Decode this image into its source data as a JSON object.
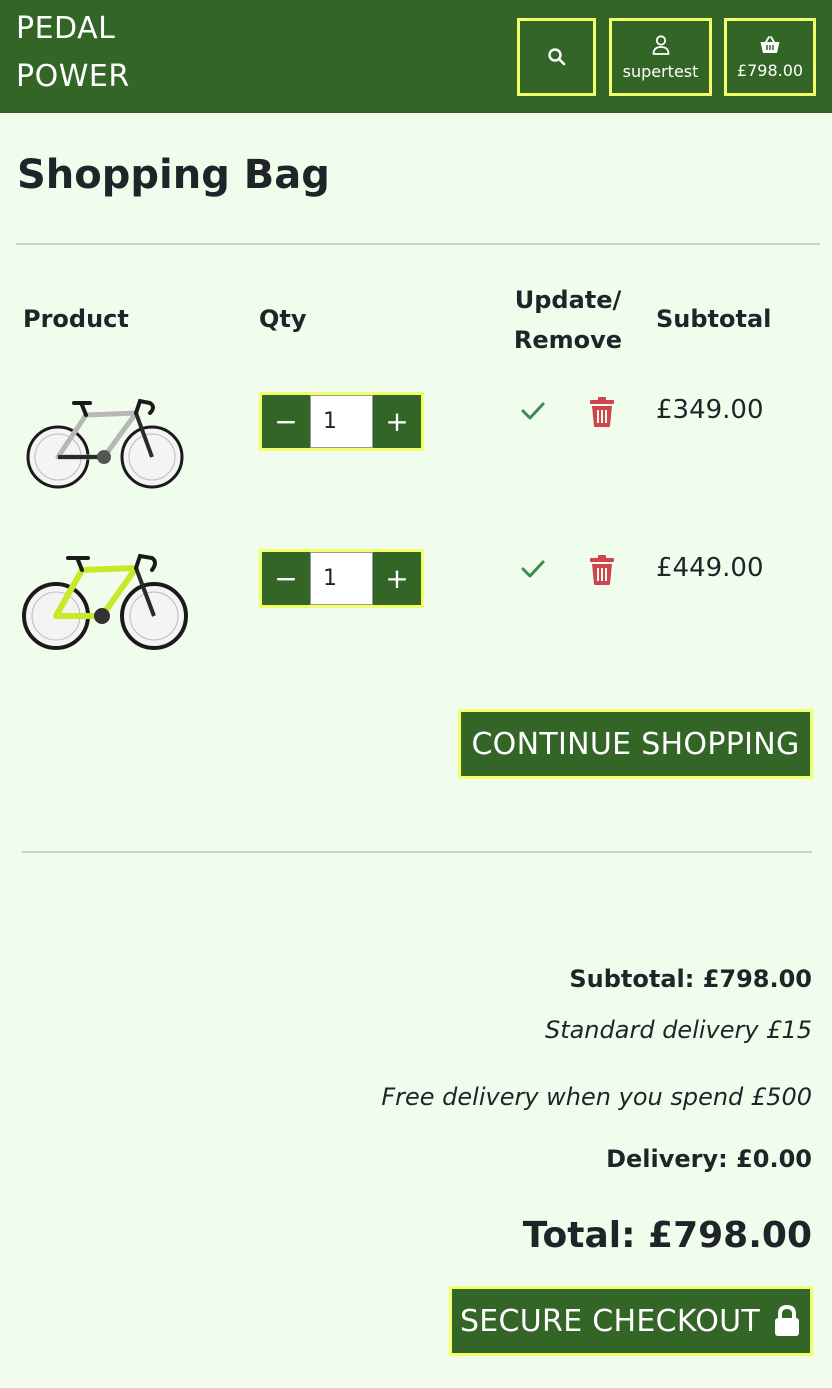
{
  "header": {
    "brand_line1": "PEDAL",
    "brand_line2": "POWER",
    "account_label": "supertest",
    "bag_total": "£798.00"
  },
  "page": {
    "title": "Shopping Bag"
  },
  "table": {
    "columns": [
      "Product",
      "Qty",
      "Update/ Remove",
      "Subtotal"
    ],
    "update_line1": "Update/",
    "update_line2": "Remove",
    "rows": [
      {
        "qty": "1",
        "subtotal": "£349.00",
        "bike_color": "silver"
      },
      {
        "qty": "1",
        "subtotal": "£449.00",
        "bike_color": "yellow-green"
      }
    ]
  },
  "stepper": {
    "minus": "−",
    "plus": "+"
  },
  "buttons": {
    "continue": "CONTINUE SHOPPING",
    "checkout": "SECURE CHECKOUT"
  },
  "summary": {
    "subtotal": "Subtotal: £798.00",
    "standard_delivery": "Standard delivery £15",
    "free_delivery": "Free delivery when you spend £500",
    "delivery": "Delivery: £0.00",
    "total": "Total: £798.00"
  },
  "icons": {
    "search": "search-icon",
    "account": "user-icon",
    "bag": "basket-icon",
    "update": "check-icon",
    "remove": "trash-icon",
    "checkout": "lock-icon"
  },
  "colors": {
    "brand_green": "#336527",
    "accent_yellow": "#f2ff6a",
    "background": "#f0fdec",
    "remove_red": "#d0454d",
    "update_green": "#3f8a4f"
  }
}
